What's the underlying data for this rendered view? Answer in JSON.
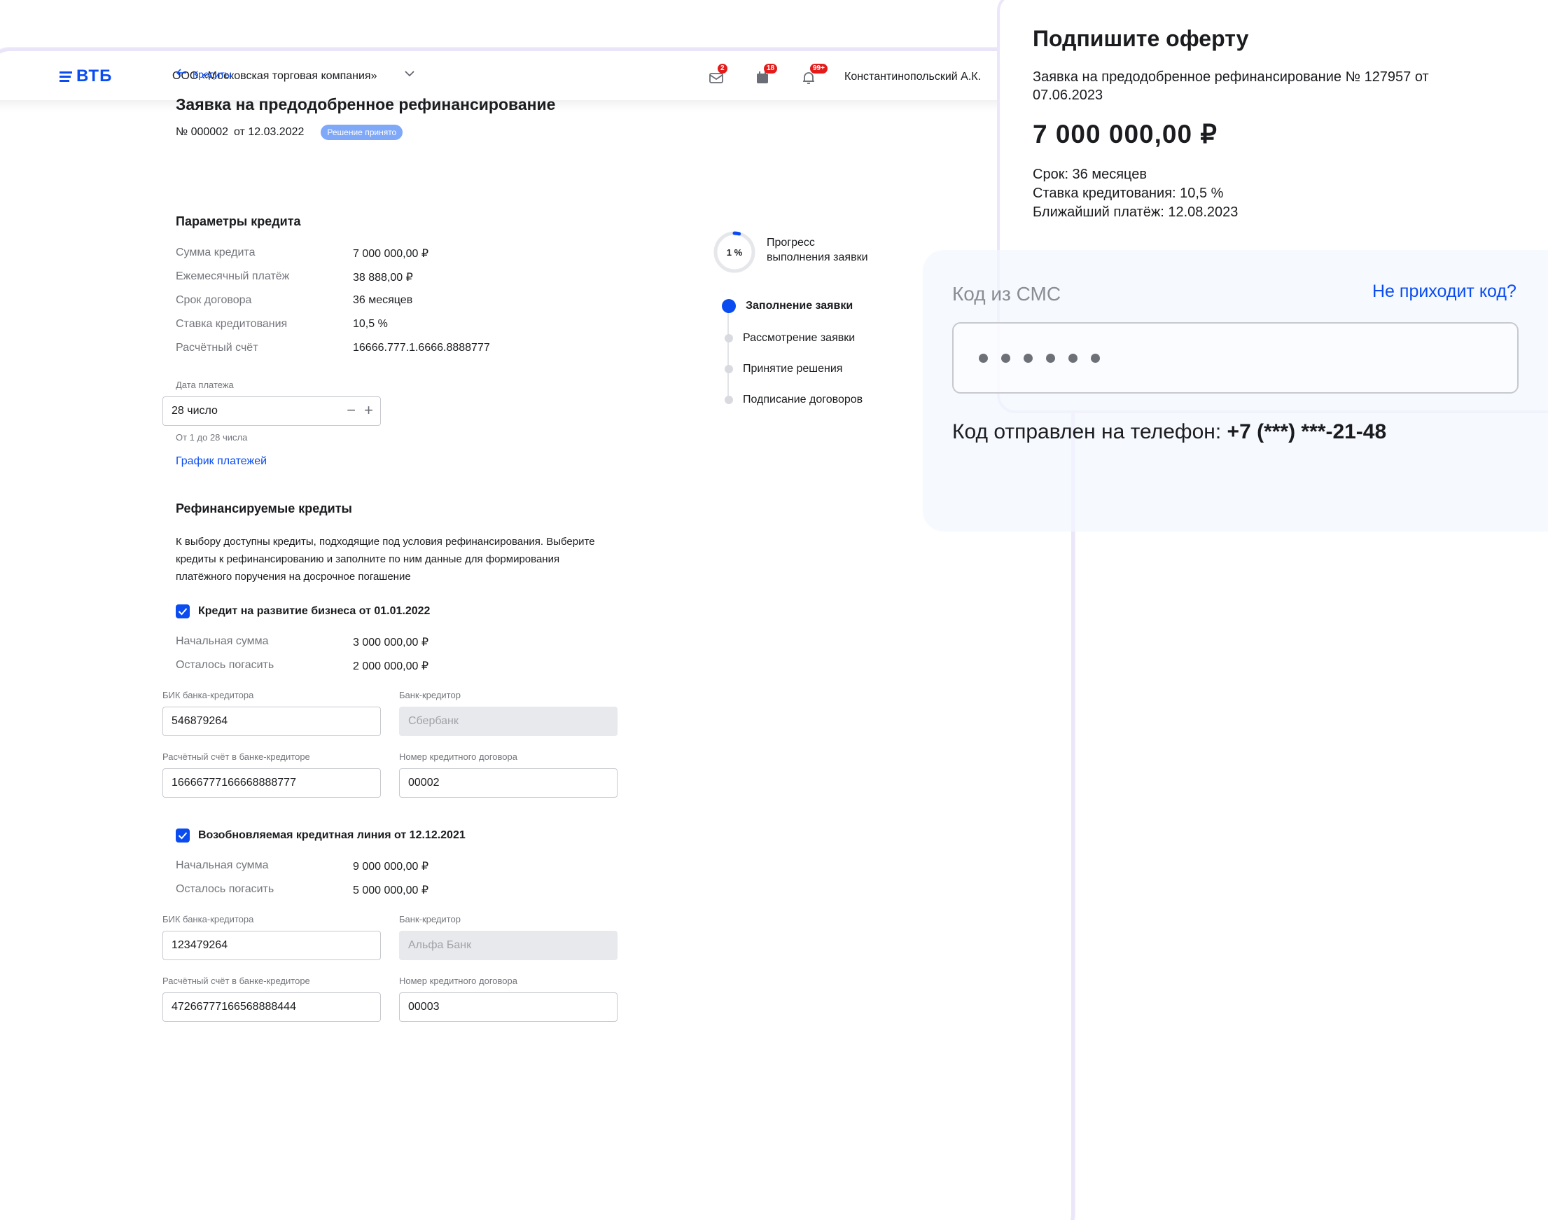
{
  "header": {
    "logo": "ВТБ",
    "company": "ООО «Московская торговая компания»",
    "icons": [
      {
        "name": "mail-icon",
        "badge": "2"
      },
      {
        "name": "calendar-icon",
        "badge": "18"
      },
      {
        "name": "bell-icon",
        "badge": "99+"
      }
    ],
    "user": "Константинопольский А.К."
  },
  "breadcrumb": {
    "back_label": "Кредиты"
  },
  "application": {
    "title": "Заявка на предодобренное рефинансирование",
    "number": "№ 000002",
    "date": "от 12.03.2022",
    "status": "Решение принято"
  },
  "credit_params": {
    "title": "Параметры кредита",
    "rows": [
      {
        "label": "Сумма кредита",
        "value": "7 000 000,00 ₽"
      },
      {
        "label": "Ежемесячный платёж",
        "value": "38 888,00 ₽"
      },
      {
        "label": "Срок договора",
        "value": "36 месяцев"
      },
      {
        "label": "Ставка кредитования",
        "value": "10,5 %"
      },
      {
        "label": "Расчётный счёт",
        "value": "16666.777.1.6666.8888777"
      }
    ],
    "payment_date_label": "Дата платежа",
    "payment_date_value": "28 число",
    "payment_date_hint": "От 1 до 28 числа",
    "schedule_link": "График платежей"
  },
  "refinanced": {
    "title": "Рефинансируемые кредиты",
    "description": "К выбору доступны кредиты, подходящие под условия рефинансирования. Выберите кредиты к рефинансированию и заполните по ним данные для формирования платёжного поручения на досрочное погашение",
    "labels": {
      "initial": "Начальная сумма",
      "remaining": "Осталось погасить",
      "bik": "БИК банка-кредитора",
      "bank": "Банк-кредитор",
      "account": "Расчётный счёт в банке-кредиторе",
      "contract": "Номер кредитного договора"
    },
    "credits": [
      {
        "title": "Кредит на развитие бизнеса от 01.01.2022",
        "checked": true,
        "initial": "3 000 000,00 ₽",
        "remaining": "2 000 000,00 ₽",
        "bik": "546879264",
        "bank": "Сбербанк",
        "account": "16666777166668888777",
        "contract": "00002"
      },
      {
        "title": "Возобновляемая кредитная линия от 12.12.2021",
        "checked": true,
        "initial": "9 000 000,00 ₽",
        "remaining": "5 000 000,00 ₽",
        "bik": "123479264",
        "bank": "Альфа Банк",
        "account": "47266777166568888444",
        "contract": "00003"
      }
    ]
  },
  "progress": {
    "percent_label": "1 %",
    "percent_value": 0.01,
    "label_line1": "Прогресс",
    "label_line2": "выполнения заявки",
    "accent_color": "#0a4cf0",
    "steps": [
      {
        "label": "Заполнение заявки",
        "active": true
      },
      {
        "label": "Рассмотрение заявки",
        "active": false
      },
      {
        "label": "Принятие решения",
        "active": false
      },
      {
        "label": "Подписание договоров",
        "active": false
      }
    ]
  },
  "offer": {
    "title": "Подпишите оферту",
    "description": "Заявка на предодобренное рефинансирование № 127957 от 07.06.2023",
    "amount": "7 000 000,00 ₽",
    "term": "Срок: 36 месяцев",
    "rate": "Ставка кредитования: 10,5 %",
    "next_payment": "Ближайший платёж: 12.08.2023"
  },
  "sms": {
    "label": "Код из СМС",
    "resend_link": "Не приходит код?",
    "entered_digits": 6,
    "sent_prefix": "Код отправлен на телефон:",
    "phone": "+7 (***) ***-21-48"
  }
}
